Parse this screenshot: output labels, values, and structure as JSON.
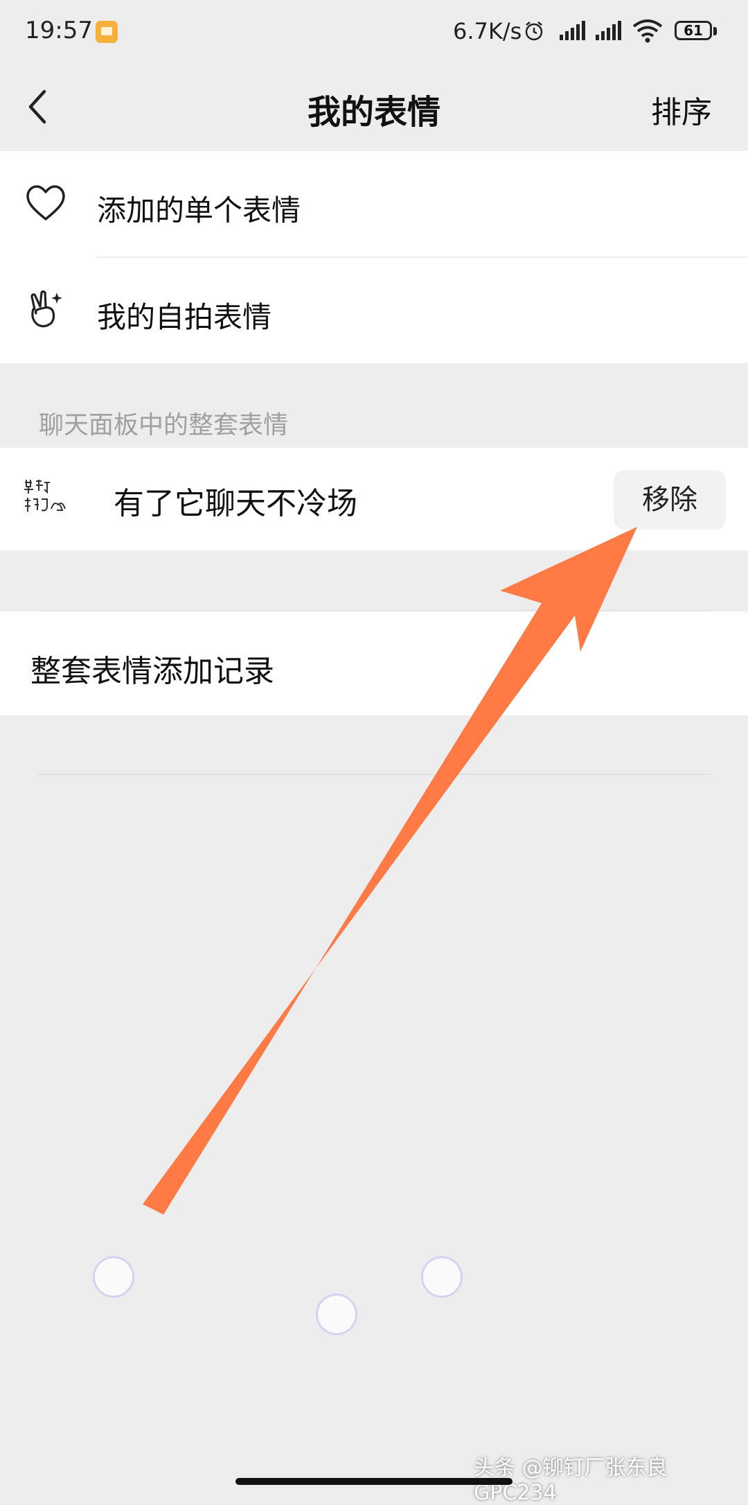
{
  "status_bar": {
    "time": "19:57",
    "net_speed": "6.7K/s",
    "battery": "61"
  },
  "nav": {
    "title": "我的表情",
    "sort_label": "排序"
  },
  "top_list": {
    "items": [
      {
        "label": "添加的单个表情",
        "icon": "heart-icon"
      },
      {
        "label": "我的自拍表情",
        "icon": "selfie-hand-icon"
      }
    ]
  },
  "section_header": "聊天面板中的整套表情",
  "sticker_pack": {
    "title": "有了它聊天不冷场",
    "remove_label": "移除"
  },
  "records": {
    "label": "整套表情添加记录"
  },
  "watermark": "头条 @铆钉厂张东良GPC234",
  "colors": {
    "background": "#ededed",
    "arrow": "#ff7a45",
    "section_header_text": "#a0a0a0"
  }
}
